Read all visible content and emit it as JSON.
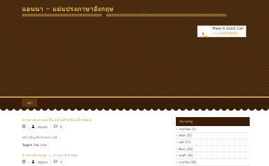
{
  "header": {
    "site_title": "แอนนา ─ แม่แปรงภาษาอังกฤษ",
    "call_label": "Make A Quick Call",
    "call_number": "+1 2345678910"
  },
  "nav": {
    "items": [
      "หน้า"
    ]
  },
  "posts": [
    {
      "title": "ภาษาอังกฤษเบื้องต้นสำหรับเด็กน้อย",
      "author": "aliyano",
      "comments": "0",
      "excerpt": "อธิบายสั้นๆเกี่ยวกับบทความนี้ ...",
      "tagged": "Tagged: ไทย, ภาษา"
    },
    {
      "title": "ภาษาอังกฤษ ─ ภาษาอังกฤษ",
      "author": "aliyano",
      "comments": "0"
    }
  ],
  "sidebar": {
    "widget_title": "หมวดหมู่",
    "categories": [
      {
        "name": "ภาษาไทย",
        "count": "(1)"
      },
      {
        "name": "คณิต",
        "count": "(21)"
      },
      {
        "name": "เคมี",
        "count": "(17)"
      },
      {
        "name": "ศิลปะ",
        "count": "(16)"
      },
      {
        "name": "ดนตรี",
        "count": "(16)"
      },
      {
        "name": "ภาษาจีน",
        "count": "(16)"
      }
    ]
  },
  "colors": {
    "header_bg": "#4a2a0c",
    "accent": "#e8b84a",
    "link": "#c8922e",
    "dark_brown": "#3a1d08"
  },
  "icons": [
    "phone-icon",
    "clock-icon",
    "user-icon",
    "comment-icon"
  ]
}
